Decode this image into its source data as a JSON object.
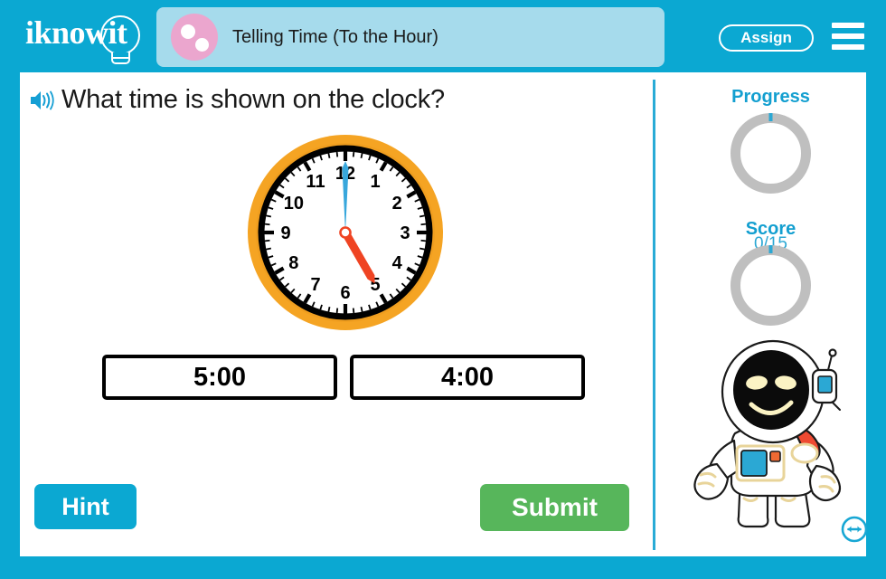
{
  "header": {
    "logo_text": "iknowit",
    "logo_icon": "lightbulb-icon",
    "title": "Telling Time (To the Hour)",
    "title_icon": "two-dots-circle-icon",
    "assign_label": "Assign",
    "menu_icon": "hamburger-menu-icon",
    "background_color": "#0BA8D2",
    "title_band_color": "#A6DBEC",
    "title_icon_color": "#EBA6CE"
  },
  "question": {
    "audio_icon": "speaker-icon",
    "text": "What time is shown on the clock?"
  },
  "clock": {
    "displayed_time": "5:00",
    "hour_hand_points_to": 5,
    "minute_hand_points_to": 12,
    "numerals": [
      "12",
      "1",
      "2",
      "3",
      "4",
      "5",
      "6",
      "7",
      "8",
      "9",
      "10",
      "11"
    ],
    "bezel_color": "#F5A423",
    "face_color": "#FFFFFF",
    "rim_color": "#000000",
    "minute_hand_color": "#38A7DC",
    "hour_hand_color": "#EF4423"
  },
  "answers": [
    {
      "label": "5:00"
    },
    {
      "label": "4:00"
    }
  ],
  "actions": {
    "hint_label": "Hint",
    "hint_color": "#0BA8D2",
    "submit_label": "Submit",
    "submit_color": "#57B65B"
  },
  "sidebar": {
    "progress": {
      "label": "Progress",
      "value": "0/15",
      "completed": 0,
      "total": 15,
      "ring_color": "#BFBFBF",
      "accent_color": "#2BA8D4"
    },
    "score": {
      "label": "Score",
      "value": "0",
      "ring_color": "#BFBFBF",
      "accent_color": "#2BA8D4"
    },
    "mascot": "astronaut-mascot",
    "resize_icon": "expand-horizontal-icon"
  }
}
